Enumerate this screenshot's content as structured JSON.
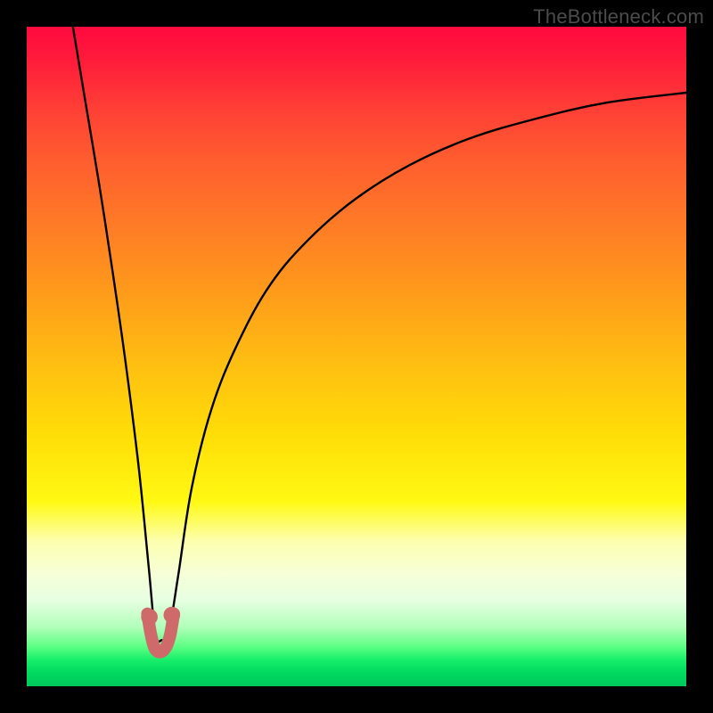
{
  "watermark": "TheBottleneck.com",
  "chart_data": {
    "type": "line",
    "title": "",
    "xlabel": "",
    "ylabel": "",
    "xlim": [
      0,
      100
    ],
    "ylim": [
      0,
      100
    ],
    "grid": false,
    "legend": false,
    "background_gradient_stops": [
      {
        "pos": 0.0,
        "color": "#ff0a3e"
      },
      {
        "pos": 0.3,
        "color": "#ff7b26"
      },
      {
        "pos": 0.62,
        "color": "#ffde08"
      },
      {
        "pos": 0.78,
        "color": "#fdffaf"
      },
      {
        "pos": 0.91,
        "color": "#b2ffba"
      },
      {
        "pos": 1.0,
        "color": "#00c95c"
      }
    ],
    "series": [
      {
        "name": "bottleneck-curve",
        "color": "#000000",
        "x": [
          7,
          9,
          11,
          13,
          15,
          17,
          18.5,
          19.5,
          20.5,
          21.5,
          23,
          25,
          28,
          32,
          37,
          43,
          50,
          58,
          67,
          77,
          88,
          100
        ],
        "y": [
          100,
          88,
          76,
          63,
          49,
          33,
          18,
          8,
          7,
          8,
          17,
          30,
          42,
          52,
          61,
          68,
          74,
          79,
          83,
          86,
          88.5,
          90
        ]
      },
      {
        "name": "highlight-dip",
        "color": "#cf6a6a",
        "x": [
          18.3,
          18.8,
          19.3,
          19.8,
          20.3,
          20.8,
          21.3,
          21.8,
          22.3
        ],
        "y": [
          11,
          8,
          6,
          5.3,
          5.2,
          5.5,
          6.3,
          8,
          11
        ]
      }
    ],
    "highlight_dots": [
      {
        "x": 18.6,
        "y": 10.5,
        "r": 1.4,
        "color": "#cf6a6a"
      },
      {
        "x": 22.0,
        "y": 10.8,
        "r": 1.4,
        "color": "#cf6a6a"
      }
    ]
  }
}
